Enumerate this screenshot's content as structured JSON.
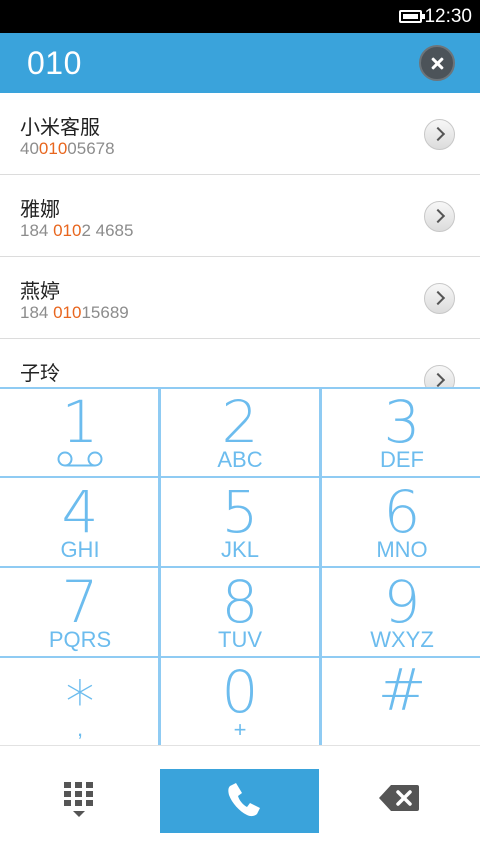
{
  "status_bar": {
    "time": "12:30",
    "battery_icon": "battery-icon"
  },
  "header": {
    "dialed_number": "010",
    "clear_icon": "close-icon"
  },
  "contacts": [
    {
      "name": "小米客服",
      "number_parts": [
        "40",
        "010",
        "05678"
      ]
    },
    {
      "name": "雅娜",
      "number_parts": [
        "184 ",
        "010",
        "2 4685"
      ]
    },
    {
      "name": "燕婷",
      "number_parts": [
        "184 ",
        "010",
        "15689"
      ]
    },
    {
      "name": "子玲",
      "number_parts": [
        "",
        "",
        ""
      ]
    }
  ],
  "keypad": [
    {
      "digit": "1",
      "letters": ""
    },
    {
      "digit": "2",
      "letters": "ABC"
    },
    {
      "digit": "3",
      "letters": "DEF"
    },
    {
      "digit": "4",
      "letters": "GHI"
    },
    {
      "digit": "5",
      "letters": "JKL"
    },
    {
      "digit": "6",
      "letters": "MNO"
    },
    {
      "digit": "7",
      "letters": "PQRS"
    },
    {
      "digit": "8",
      "letters": "TUV"
    },
    {
      "digit": "9",
      "letters": "WXYZ"
    },
    {
      "digit": "*",
      "letters": ","
    },
    {
      "digit": "0",
      "letters": "+"
    },
    {
      "digit": "#",
      "letters": ""
    }
  ],
  "actions": {
    "dialpad_icon": "dialpad-icon",
    "call_icon": "phone-icon",
    "delete_icon": "backspace-icon"
  },
  "colors": {
    "accent": "#3aa3db",
    "highlight": "#e8661e",
    "key_text": "#6cbcee",
    "key_lines": "#8fcbf3"
  }
}
